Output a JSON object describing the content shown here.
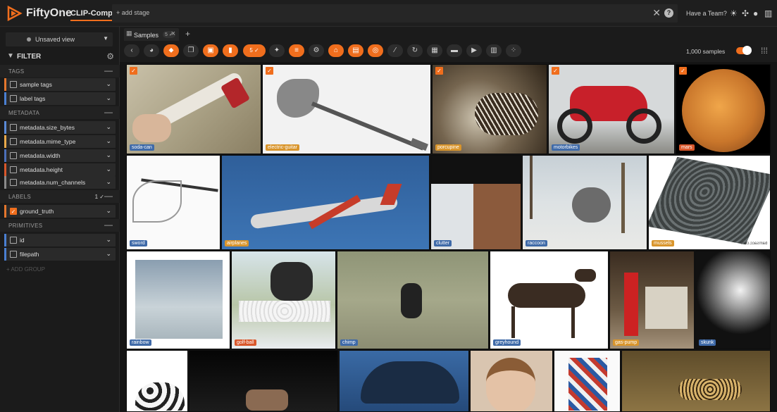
{
  "app": {
    "title": "FiftyOne",
    "dataset": "CLIP-Comp",
    "add_stage": "+ add stage",
    "team": "Have a Team?"
  },
  "sidebar": {
    "view": "Unsaved view",
    "filter": "FILTER",
    "groups": {
      "tags": "TAGS",
      "metadata": "METADATA",
      "labels": "LABELS",
      "labels_count": "1 ✓",
      "primitives": "PRIMITIVES"
    },
    "fields": {
      "sample_tags": "sample tags",
      "label_tags": "label tags",
      "size_bytes": "metadata.size_bytes",
      "mime_type": "metadata.mime_type",
      "width": "metadata.width",
      "height": "metadata.height",
      "num_channels": "metadata.num_channels",
      "ground_truth": "ground_truth",
      "id": "id",
      "filepath": "filepath"
    },
    "add_group": "+ ADD GROUP"
  },
  "tabs": {
    "samples": "Samples",
    "samples_badge": "5 ✓"
  },
  "toolbar": {
    "selected_count": "5 ✓",
    "sample_count": "1,000 samples"
  },
  "colors": {
    "accent": "#f06e1d",
    "bg": "#151515",
    "panel": "#1b1b1b"
  },
  "labels": {
    "soda_can": "soda-can",
    "electric_guitar": "electric-guitar",
    "porcupine": "porcupine",
    "motorbikes": "motorbikes",
    "mars": "mars",
    "sword": "sword",
    "airplanes": "airplanes",
    "clutter": "clutter",
    "raccoon": "raccoon",
    "mussels": "mussels",
    "rainbow": "rainbow",
    "golf_ball": "golf-ball",
    "chimp": "chimp",
    "greyhound": "greyhound",
    "gas_pump": "gas-pump",
    "skunk": "skunk"
  },
  "image_text": {
    "mussels_watermark": "barnsacc.com"
  }
}
